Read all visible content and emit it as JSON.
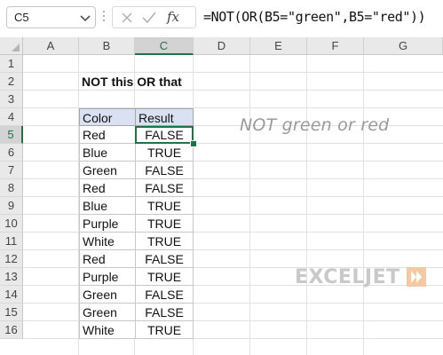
{
  "formula_bar": {
    "name_box": "C5",
    "fx_label": "fx",
    "formula": "=NOT(OR(B5=\"green\",B5=\"red\"))"
  },
  "columns": [
    "A",
    "B",
    "C",
    "D",
    "E",
    "F",
    "G"
  ],
  "rows": [
    "1",
    "2",
    "3",
    "4",
    "5",
    "6",
    "7",
    "8",
    "9",
    "10",
    "11",
    "12",
    "13",
    "14",
    "15",
    "16"
  ],
  "active_cell": {
    "column": "C",
    "row": "5"
  },
  "sheet": {
    "title": "NOT this OR that",
    "table": {
      "headers": {
        "color": "Color",
        "result": "Result"
      },
      "rows": [
        {
          "color": "Red",
          "result": "FALSE"
        },
        {
          "color": "Blue",
          "result": "TRUE"
        },
        {
          "color": "Green",
          "result": "FALSE"
        },
        {
          "color": "Red",
          "result": "FALSE"
        },
        {
          "color": "Blue",
          "result": "TRUE"
        },
        {
          "color": "Purple",
          "result": "TRUE"
        },
        {
          "color": "White",
          "result": "TRUE"
        },
        {
          "color": "Red",
          "result": "FALSE"
        },
        {
          "color": "Purple",
          "result": "TRUE"
        },
        {
          "color": "Green",
          "result": "FALSE"
        },
        {
          "color": "Green",
          "result": "FALSE"
        },
        {
          "color": "White",
          "result": "TRUE"
        }
      ]
    },
    "annotation": "NOT green or red"
  },
  "branding": {
    "logo_text": "EXCELJET"
  },
  "colors": {
    "accent": "#217346",
    "header_fill": "#d9e1f2",
    "annotation": "#9a9a9a"
  },
  "icons": {
    "name_box_dropdown": "chevron-down-icon",
    "cancel": "close-icon",
    "enter": "check-icon",
    "insert_function": "fx-icon",
    "select_all": "select-all-icon",
    "logo": "exceljet-logo-icon"
  }
}
